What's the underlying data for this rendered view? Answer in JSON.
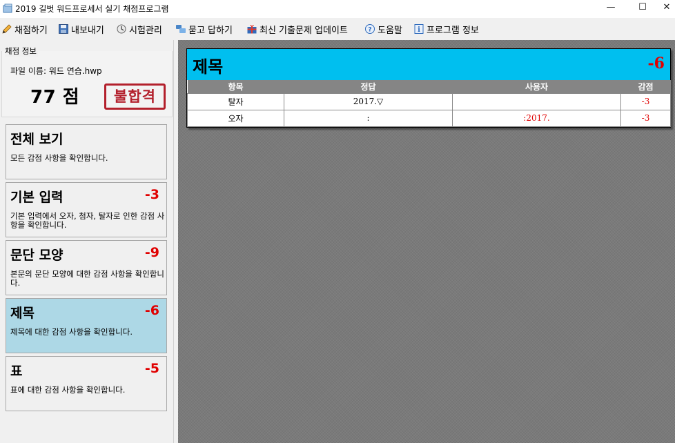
{
  "window": {
    "title": "2019 길벗 워드프로세서 실기 채점프로그램",
    "min_glyph": "—",
    "max_glyph": "☐",
    "close_glyph": "✕"
  },
  "menu": [
    {
      "label": "채점하기",
      "icon": "pencil-icon"
    },
    {
      "label": "내보내기",
      "icon": "save-icon"
    },
    {
      "label": "시험관리",
      "icon": "exam-manage-icon"
    },
    {
      "label": "묻고 답하기",
      "icon": "qa-icon"
    },
    {
      "label": "최신 기출문제 업데이트",
      "icon": "gift-update-icon"
    },
    {
      "label": "도움말",
      "icon": "help-icon"
    },
    {
      "label": "프로그램 정보",
      "icon": "info-icon"
    }
  ],
  "grade_info": {
    "section_title": "채점 정보",
    "file_name": "파일 이름: 워드 연습.hwp",
    "score": "77 점",
    "result_stamp": "불합격"
  },
  "categories": [
    {
      "title": "전체 보기",
      "deduction": "",
      "desc": "모든 감점 사항을 확인합니다.",
      "active": false
    },
    {
      "title": "기본 입력",
      "deduction": "-3",
      "desc": "기본 입력에서 오자, 첨자, 탈자로 인한 감점 사항을 확인합니다.",
      "active": false
    },
    {
      "title": "문단 모양",
      "deduction": "-9",
      "desc": "본문의 문단 모양에 대한 감점 사항을 확인합니다.",
      "active": false
    },
    {
      "title": "제목",
      "deduction": "-6",
      "desc": "제목에 대한 감점 사항을 확인합니다.",
      "active": true
    },
    {
      "title": "표",
      "deduction": "-5",
      "desc": "표에 대한 감점 사항을 확인합니다.",
      "active": false
    }
  ],
  "detail": {
    "title": "제목",
    "total": "-6",
    "columns": [
      "항목",
      "정답",
      "사용자",
      "감점"
    ],
    "rows": [
      {
        "item": "탈자",
        "answer": "2017.▽",
        "user": "",
        "deduction": "-3"
      },
      {
        "item": "오자",
        "answer": ":",
        "user": ":2017.",
        "deduction": "-3"
      }
    ]
  },
  "colors": {
    "accent_header": "#00bfef",
    "active_card": "#add8e6",
    "deduction_red": "#e00000",
    "stamp_red": "#b3202c"
  }
}
